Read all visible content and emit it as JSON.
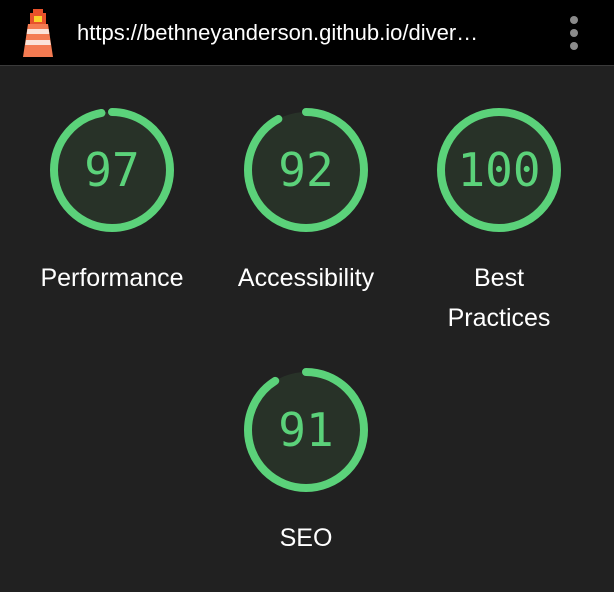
{
  "toolbar": {
    "url": "https://bethneyanderson.github.io/diver…",
    "logo_icon": "lighthouse-icon",
    "menu_icon": "more-vert-icon"
  },
  "colors": {
    "pass": "#5bd27a",
    "pass_track": "#283228",
    "background": "#212121"
  },
  "gauges": [
    {
      "score": 97,
      "label": "Performance"
    },
    {
      "score": 92,
      "label": "Accessibility"
    },
    {
      "score": 100,
      "label": "Best Practices"
    },
    {
      "score": 91,
      "label": "SEO"
    }
  ]
}
